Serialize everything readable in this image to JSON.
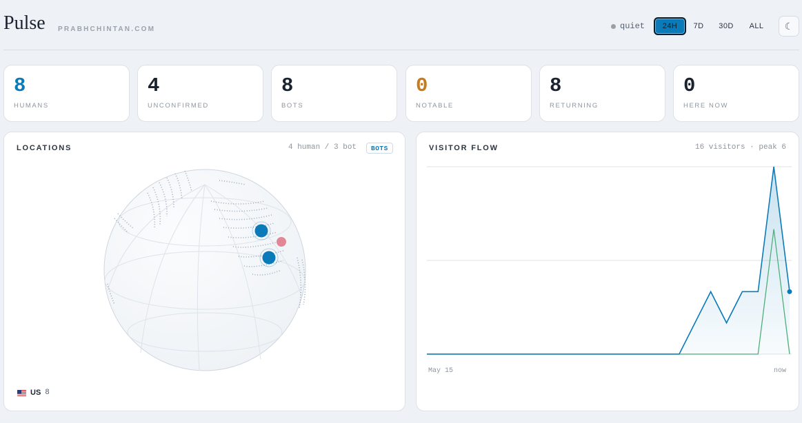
{
  "header": {
    "brand": "Pulse",
    "domain": "PRABHCHINTAN.COM",
    "status_text": "quiet",
    "ranges": [
      "24H",
      "7D",
      "30D",
      "ALL"
    ],
    "active_range": "24H",
    "theme_icon": "☾"
  },
  "stats": [
    {
      "value": "8",
      "label": "HUMANS",
      "color": "#0a7ab8"
    },
    {
      "value": "4",
      "label": "UNCONFIRMED",
      "color": "#1b2330"
    },
    {
      "value": "8",
      "label": "BOTS",
      "color": "#1b2330"
    },
    {
      "value": "0",
      "label": "NOTABLE",
      "color": "#c77a1e"
    },
    {
      "value": "8",
      "label": "RETURNING",
      "color": "#1b2330"
    },
    {
      "value": "0",
      "label": "HERE NOW",
      "color": "#1b2330"
    }
  ],
  "locations": {
    "title": "LOCATIONS",
    "meta": "4 human / 3 bot",
    "badge": "BOTS",
    "countries": [
      {
        "code": "US",
        "count": "8"
      }
    ],
    "colors": {
      "human": "#0a7ab8",
      "bot": "#e07b8a"
    }
  },
  "visitor_flow": {
    "title": "VISITOR FLOW",
    "meta": "16 visitors · peak 6",
    "x_start_label": "May 15",
    "x_end_label": "now"
  },
  "chart_data": {
    "type": "area",
    "title": "VISITOR FLOW",
    "xlabel": "",
    "ylabel": "",
    "ylim": [
      0,
      6
    ],
    "grid": true,
    "x_labels": [
      "May 15",
      "now"
    ],
    "series": [
      {
        "color": "#0a7ab8",
        "values": [
          0,
          0,
          0,
          0,
          0,
          0,
          0,
          0,
          0,
          0,
          0,
          0,
          0,
          0,
          0,
          0,
          0,
          1,
          2,
          1,
          2,
          2,
          6,
          2
        ]
      },
      {
        "color": "#4caf7a",
        "values": [
          0,
          0,
          0,
          0,
          0,
          0,
          0,
          0,
          0,
          0,
          0,
          0,
          0,
          0,
          0,
          0,
          0,
          0,
          0,
          0,
          0,
          0,
          4,
          0
        ]
      }
    ]
  }
}
